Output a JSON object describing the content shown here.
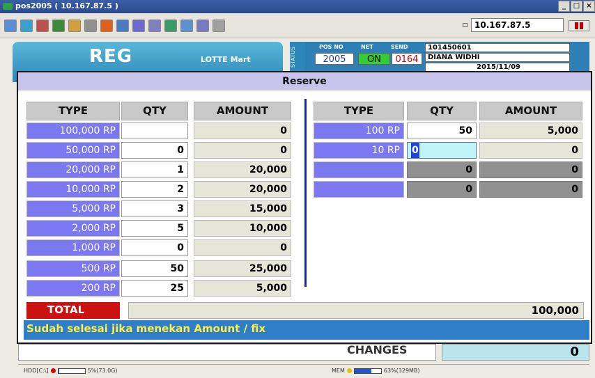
{
  "window": {
    "title": "pos2005 ( 10.167.87.5 )",
    "controls": [
      "_",
      "□",
      "×"
    ]
  },
  "toolbar": {
    "ip_address": "10.167.87.5",
    "icon_colors": [
      "#5b8ed6",
      "#3aa0d0",
      "#c05050",
      "#3a8a3a",
      "#d0a040",
      "#909090",
      "#e06020",
      "#4a7ac0",
      "#6a6ad0",
      "#8080c0",
      "#3a9a6a",
      "#6090d0",
      "#7a7ac0",
      "#a0a0a0"
    ]
  },
  "background": {
    "reg_label": "REG",
    "brand": "LOTTE Mart",
    "status_label": "STATUS",
    "pos_no_header": "POS NO",
    "pos_no": "2005",
    "net_header": "NET",
    "net": "ON",
    "send_header": "SEND",
    "send": "0164",
    "account": "101450601",
    "cashier": "DIANA WIDHI",
    "date": "2015/11/09",
    "changes_label": "CHANGES",
    "changes_value": "0"
  },
  "statusbar": {
    "hdd_label": "HDD[C:\\]",
    "hdd_value": "5%(73.0G)",
    "hdd_level": 0.05,
    "mem_label": "MEM",
    "mem_value": "63%(329MB)",
    "mem_level": 0.63
  },
  "dialog": {
    "title": "Reserve",
    "left_headers": {
      "type": "TYPE",
      "qty": "QTY",
      "amount": "AMOUNT"
    },
    "right_headers": {
      "type": "TYPE",
      "qty": "QTY",
      "amount": "AMOUNT"
    },
    "left_rows": [
      {
        "type": "100,000 RP",
        "qty": "",
        "amount": "0"
      },
      {
        "type": "50,000 RP",
        "qty": "0",
        "amount": "0"
      },
      {
        "type": "20,000 RP",
        "qty": "1",
        "amount": "20,000"
      },
      {
        "type": "10,000 RP",
        "qty": "2",
        "amount": "20,000"
      },
      {
        "type": "5,000 RP",
        "qty": "3",
        "amount": "15,000"
      },
      {
        "type": "2,000 RP",
        "qty": "5",
        "amount": "10,000"
      },
      {
        "type": "1,000 RP",
        "qty": "0",
        "amount": "0"
      },
      {
        "type": "500 RP",
        "qty": "50",
        "amount": "25,000"
      },
      {
        "type": "200 RP",
        "qty": "25",
        "amount": "5,000"
      }
    ],
    "right_rows": [
      {
        "type": "100 RP",
        "qty": "50",
        "amount": "5,000"
      },
      {
        "type": "10 RP",
        "qty": "0",
        "amount": "0"
      },
      {
        "type": "",
        "qty": "0",
        "amount": "0"
      },
      {
        "type": "",
        "qty": "0",
        "amount": "0"
      }
    ],
    "total_label": "TOTAL",
    "total_value": "100,000",
    "message": "Sudah selesai jika menekan Amount / fix"
  }
}
